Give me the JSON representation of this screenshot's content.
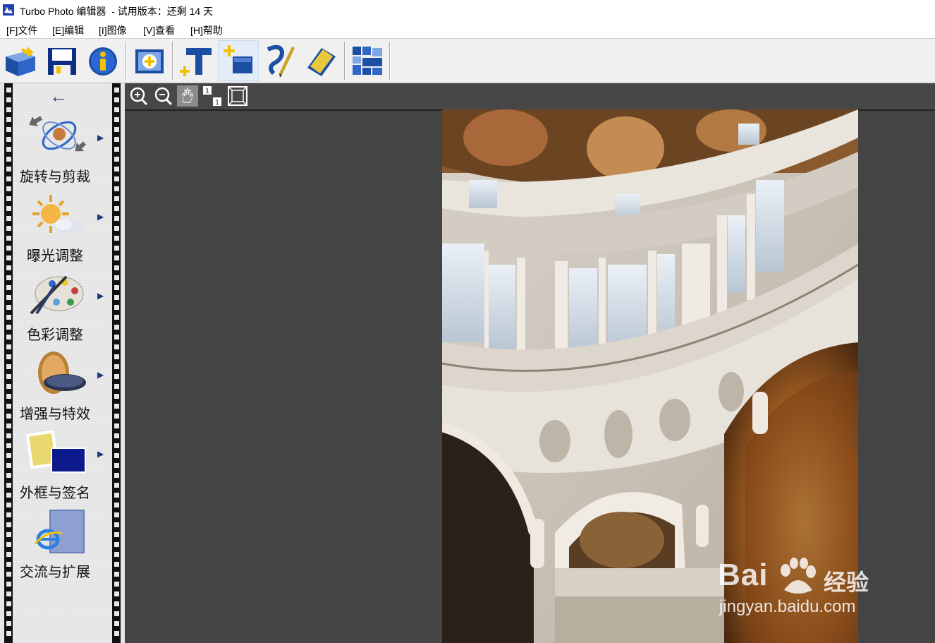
{
  "window": {
    "title": "Turbo Photo 编辑器  - 试用版本：还剩 14 天"
  },
  "menu": [
    {
      "label": "[F]文件"
    },
    {
      "label": "[E]编辑"
    },
    {
      "label": "[I]图像"
    },
    {
      "label": "[V]查看"
    },
    {
      "label": "[H]帮助"
    }
  ],
  "toolbar": {
    "icons": [
      "open-icon",
      "save-icon",
      "info-icon",
      "add-photo-icon",
      "add-text-icon",
      "add-layer-icon",
      "brush-icon",
      "eraser-icon",
      "batch-icon"
    ]
  },
  "sidebar": {
    "back_icon": "←",
    "tools": [
      {
        "label": "旋转与剪裁",
        "icon": "rotate-crop-icon"
      },
      {
        "label": "曝光调整",
        "icon": "exposure-icon"
      },
      {
        "label": "色彩调整",
        "icon": "palette-icon"
      },
      {
        "label": "增强与特效",
        "icon": "lens-filter-icon"
      },
      {
        "label": "外框与签名",
        "icon": "frame-signature-icon"
      },
      {
        "label": "交流与扩展",
        "icon": "share-extend-icon"
      }
    ],
    "expand_arrow": "▶"
  },
  "viewbar": {
    "icons": [
      "zoom-in-icon",
      "zoom-out-icon",
      "pan-hand-icon",
      "actual-size-icon",
      "fit-window-icon"
    ],
    "actual_size_label": "1"
  },
  "watermark": {
    "brand": "Bai",
    "brand_cn": "经验",
    "url": "jingyan.baidu.com"
  },
  "colors": {
    "canvas_bg": "#444444",
    "sidebar_bg": "#e6e6e6",
    "toolbar_bg": "#f0f0f0",
    "accent_blue": "#1c4fa3"
  }
}
